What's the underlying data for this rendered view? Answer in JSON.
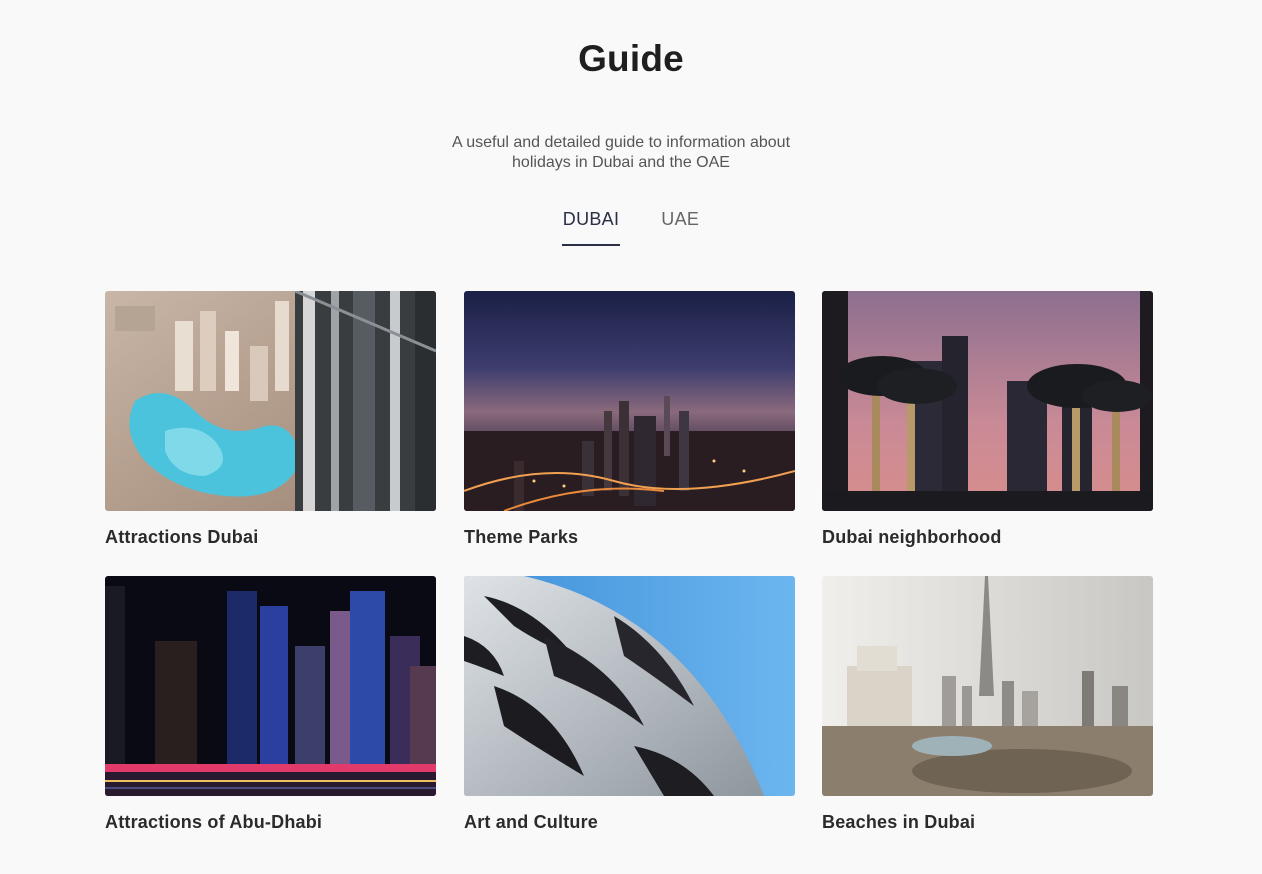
{
  "page": {
    "title": "Guide",
    "subtitle": "A useful and detailed guide to information about holidays in Dubai and the OAE"
  },
  "tabs": [
    {
      "label": "DUBAI",
      "active": true
    },
    {
      "label": "UAE",
      "active": false
    }
  ],
  "cards": [
    {
      "label": "Attractions Dubai",
      "image": "aerial-city-lagoon-photo"
    },
    {
      "label": "Theme Parks",
      "image": "dubai-skyline-dusk-photo"
    },
    {
      "label": "Dubai neighborhood",
      "image": "palm-trees-lights-photo"
    },
    {
      "label": "Attractions of Abu-Dhabi",
      "image": "night-skyscrapers-photo"
    },
    {
      "label": "Art and Culture",
      "image": "calligraphy-facade-photo"
    },
    {
      "label": "Beaches in Dubai",
      "image": "burj-khalifa-haze-photo"
    }
  ],
  "colors": {
    "background": "#f9f9f9",
    "active_tab_underline": "#2a2f45"
  }
}
